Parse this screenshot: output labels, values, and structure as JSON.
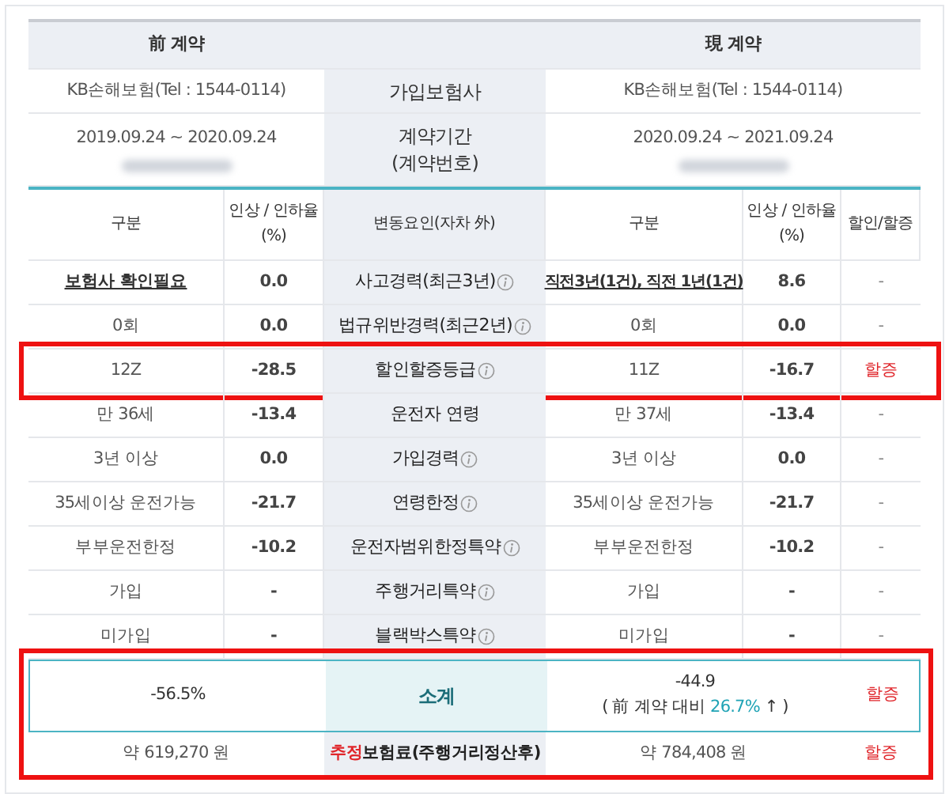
{
  "header": {
    "previous": "前 계약",
    "current": "現 계약"
  },
  "insurer": {
    "label": "가입보험사",
    "previous": "KB손해보험(Tel : 1544-0114)",
    "current": "KB손해보험(Tel : 1544-0114)"
  },
  "period": {
    "label_lines": [
      "계약기간",
      "(계약번호)"
    ],
    "previous": "2019.09.24 ~ 2020.09.24",
    "current": "2020.09.24 ~ 2021.09.24"
  },
  "columns": {
    "previous": [
      "구분",
      "인상 / 인하율 (%)"
    ],
    "factor": "변동요인(자차 外)",
    "current": [
      "구분",
      "인상 / 인하율 (%)",
      "할인/할증"
    ]
  },
  "rows": [
    {
      "factor": "사고경력(최근3년)",
      "info": true,
      "prev_value": "보험사 확인필요",
      "prev_link": true,
      "prev_rate": "0.0",
      "cur_value": "직전3년(1건), 직전 1년(1건)",
      "cur_link": true,
      "cur_rate": "8.6",
      "change": "-",
      "surcharge": false,
      "highlighted": false
    },
    {
      "factor": "법규위반경력(최근2년)",
      "info": true,
      "prev_value": "0회",
      "prev_link": false,
      "prev_rate": "0.0",
      "cur_value": "0회",
      "cur_link": false,
      "cur_rate": "0.0",
      "change": "-",
      "surcharge": false,
      "highlighted": false
    },
    {
      "factor": "할인할증등급",
      "info": true,
      "prev_value": "12Z",
      "prev_link": false,
      "prev_rate": "-28.5",
      "cur_value": "11Z",
      "cur_link": false,
      "cur_rate": "-16.7",
      "change": "할증",
      "surcharge": true,
      "highlighted": true
    },
    {
      "factor": "운전자 연령",
      "info": false,
      "prev_value": "만 36세",
      "prev_link": false,
      "prev_rate": "-13.4",
      "cur_value": "만 37세",
      "cur_link": false,
      "cur_rate": "-13.4",
      "change": "-",
      "surcharge": false,
      "highlighted": false
    },
    {
      "factor": "가입경력",
      "info": true,
      "prev_value": "3년 이상",
      "prev_link": false,
      "prev_rate": "0.0",
      "cur_value": "3년 이상",
      "cur_link": false,
      "cur_rate": "0.0",
      "change": "-",
      "surcharge": false,
      "highlighted": false
    },
    {
      "factor": "연령한정",
      "info": true,
      "prev_value": "35세이상 운전가능",
      "prev_link": false,
      "prev_rate": "-21.7",
      "cur_value": "35세이상 운전가능",
      "cur_link": false,
      "cur_rate": "-21.7",
      "change": "-",
      "surcharge": false,
      "highlighted": false
    },
    {
      "factor": "운전자범위한정특약",
      "info": true,
      "prev_value": "부부운전한정",
      "prev_link": false,
      "prev_rate": "-10.2",
      "cur_value": "부부운전한정",
      "cur_link": false,
      "cur_rate": "-10.2",
      "change": "-",
      "surcharge": false,
      "highlighted": false
    },
    {
      "factor": "주행거리특약",
      "info": true,
      "prev_value": "가입",
      "prev_link": false,
      "prev_rate": "-",
      "cur_value": "가입",
      "cur_link": false,
      "cur_rate": "-",
      "change": "-",
      "surcharge": false,
      "highlighted": false
    },
    {
      "factor": "블랙박스특약",
      "info": true,
      "prev_value": "미가입",
      "prev_link": false,
      "prev_rate": "-",
      "cur_value": "미가입",
      "cur_link": false,
      "cur_rate": "-",
      "change": "-",
      "surcharge": false,
      "highlighted": false
    }
  ],
  "summary": {
    "highlighted": true,
    "subtotal": {
      "label": "소계",
      "previous": "-56.5%",
      "current": "-44.9",
      "comparison_prefix": "( 前 계약 대비 ",
      "comparison_value": "26.7%",
      "comparison_suffix": " ↑ )",
      "change": "할증",
      "surcharge": true
    },
    "premium": {
      "label_accent": "추정",
      "label": "보험료(주행거리정산후)",
      "previous": "약 619,270 원",
      "current": "약 784,408 원",
      "change": "할증",
      "surcharge": true
    }
  }
}
